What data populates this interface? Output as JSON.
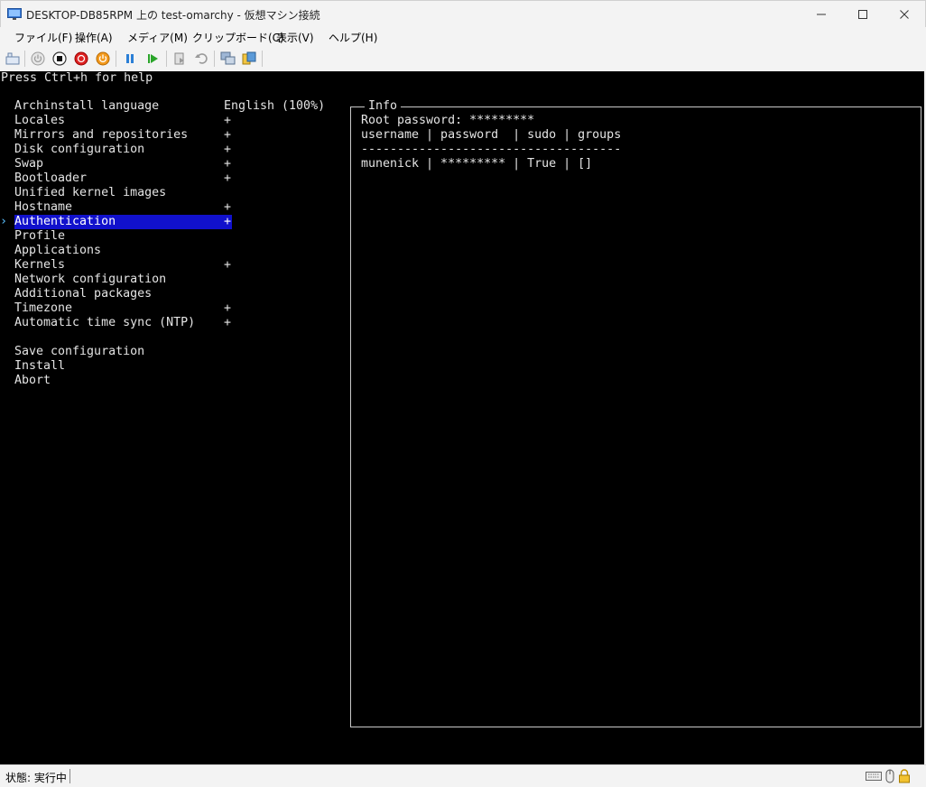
{
  "window": {
    "title": "DESKTOP-DB85RPM 上の test-omarchy - 仮想マシン接続"
  },
  "menu": [
    "ファイル(F)",
    "操作(A)",
    "メディア(M)",
    "クリップボード(C)",
    "表示(V)",
    "ヘルプ(H)"
  ],
  "console": {
    "help": "Press Ctrl+h for help",
    "cursor": "›",
    "items": [
      {
        "label": "Archinstall language",
        "value": "English (100%)"
      },
      {
        "label": "Locales",
        "value": "+"
      },
      {
        "label": "Mirrors and repositories",
        "value": "+"
      },
      {
        "label": "Disk configuration",
        "value": "+"
      },
      {
        "label": "Swap",
        "value": "+"
      },
      {
        "label": "Bootloader",
        "value": "+"
      },
      {
        "label": "Unified kernel images",
        "value": ""
      },
      {
        "label": "Hostname",
        "value": "+"
      },
      {
        "label": "Authentication",
        "value": "+"
      },
      {
        "label": "Profile",
        "value": ""
      },
      {
        "label": "Applications",
        "value": ""
      },
      {
        "label": "Kernels",
        "value": "+"
      },
      {
        "label": "Network configuration",
        "value": ""
      },
      {
        "label": "Additional packages",
        "value": ""
      },
      {
        "label": "Timezone",
        "value": "+"
      },
      {
        "label": "Automatic time sync (NTP)",
        "value": "+"
      }
    ],
    "actions": [
      {
        "label": "Save configuration"
      },
      {
        "label": "Install"
      },
      {
        "label": "Abort"
      }
    ],
    "info": {
      "title": "Info",
      "lines": [
        "Root password: *********",
        "username | password  | sudo | groups",
        "------------------------------------",
        "munenick | ********* | True | []"
      ]
    }
  },
  "status": {
    "text": "状態: 実行中"
  },
  "colors": {
    "selection": "#1111cc",
    "cursor": "#5bc0ff"
  }
}
